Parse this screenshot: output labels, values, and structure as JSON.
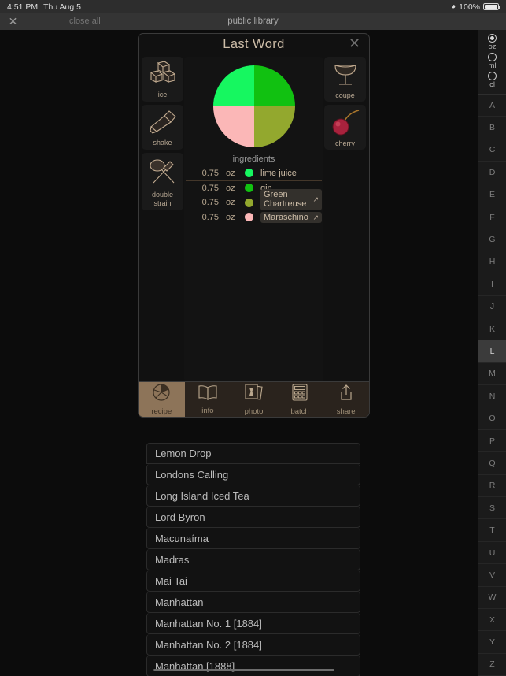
{
  "status_bar": {
    "time": "4:51 PM",
    "date": "Thu Aug 5",
    "wifi_icon": "wifi-icon",
    "battery_percent": "100%",
    "battery_icon": "battery-full-icon"
  },
  "app_bar": {
    "close_icon": "close-icon",
    "close_all_label": "close all",
    "title": "public library"
  },
  "modal": {
    "title": "Last Word",
    "close_icon": "close-icon",
    "tools": [
      {
        "label": "ice",
        "icon": "ice-cubes-icon"
      },
      {
        "label": "shake",
        "icon": "cocktail-shaker-icon"
      },
      {
        "label": "double\nstrain",
        "label_line1": "double",
        "label_line2": "strain",
        "icon": "double-strain-icon"
      }
    ],
    "garnishes": [
      {
        "label": "coupe",
        "icon": "coupe-glass-icon"
      },
      {
        "label": "cherry",
        "icon": "cherry-icon"
      }
    ],
    "ingredients_header": "ingredients",
    "ingredients": [
      {
        "amount": "0.75",
        "unit": "oz",
        "name": "lime juice",
        "color": "#16F760",
        "link": false
      },
      {
        "amount": "0.75",
        "unit": "oz",
        "name": "gin",
        "color": "#11C111",
        "link": false
      },
      {
        "amount": "0.75",
        "unit": "oz",
        "name": "Green Chartreuse",
        "name_line1": "Green",
        "name_line2": "Chartreuse",
        "color": "#93A82E",
        "link": true
      },
      {
        "amount": "0.75",
        "unit": "oz",
        "name": "Maraschino",
        "color": "#FBB7B7",
        "link": true
      }
    ],
    "external_link_icon": "external-link-icon",
    "tabs": [
      {
        "label": "recipe",
        "icon": "pie-chart-icon",
        "active": true
      },
      {
        "label": "info",
        "icon": "open-book-icon",
        "active": false
      },
      {
        "label": "photo",
        "icon": "photos-icon",
        "active": false
      },
      {
        "label": "batch",
        "icon": "calculator-icon",
        "active": false
      },
      {
        "label": "share",
        "icon": "share-icon",
        "active": false
      }
    ]
  },
  "chart_data": {
    "type": "pie",
    "title": "ingredients",
    "categories": [
      "lime juice",
      "gin",
      "Green Chartreuse",
      "Maraschino"
    ],
    "values": [
      0.75,
      0.75,
      0.75,
      0.75
    ],
    "unit": "oz",
    "colors": [
      "#16F760",
      "#11C111",
      "#93A82E",
      "#FBB7B7"
    ],
    "legend": "table",
    "slice_order": [
      "top-left",
      "top-right",
      "bottom-right",
      "bottom-left"
    ]
  },
  "unit_selector": {
    "options": [
      {
        "label": "oz",
        "selected": true
      },
      {
        "label": "ml",
        "selected": false
      },
      {
        "label": "cl",
        "selected": false
      }
    ]
  },
  "letter_index": {
    "letters": [
      "A",
      "B",
      "C",
      "D",
      "E",
      "F",
      "G",
      "H",
      "I",
      "J",
      "K",
      "L",
      "M",
      "N",
      "O",
      "P",
      "Q",
      "R",
      "S",
      "T",
      "U",
      "V",
      "W",
      "X",
      "Y",
      "Z"
    ],
    "selected": "L"
  },
  "drink_list": [
    "Lemon Drop",
    "Londons Calling",
    "Long Island Iced Tea",
    "Lord Byron",
    "Macunaíma",
    "Madras",
    "Mai Tai",
    "Manhattan",
    "Manhattan No. 1 [1884]",
    "Manhattan No. 2 [1884]",
    "Manhattan [1888]"
  ],
  "colors": {
    "accent": "#8d7459",
    "text_tan": "#c9b9a3",
    "background": "#0c0c0c",
    "panel": "#131313"
  }
}
